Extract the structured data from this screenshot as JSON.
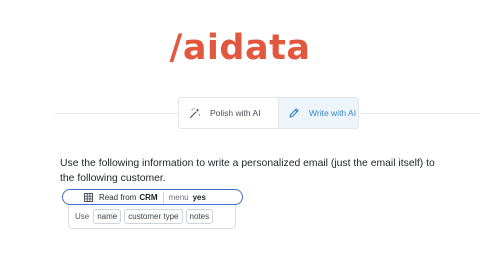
{
  "brand": {
    "logo_text": "/aidata",
    "color": "#e2583f"
  },
  "toolbar": {
    "polish_label": "Polish with AI",
    "polish_icon": "magic-wand-icon",
    "write_label": "Write with AI",
    "write_icon": "pencil-icon",
    "active": "write",
    "accent": "#3a86c8"
  },
  "prompt": {
    "line1": "Use the following information to write a personalized email (just the email itself) to",
    "line2": "the following customer."
  },
  "crm_block": {
    "read_label": "Read from",
    "source": "CRM",
    "menu_key": "menu",
    "menu_value": "yes",
    "icon": "table-grid-icon",
    "use_label": "Use",
    "fields": [
      "name",
      "customer type",
      "notes"
    ]
  }
}
